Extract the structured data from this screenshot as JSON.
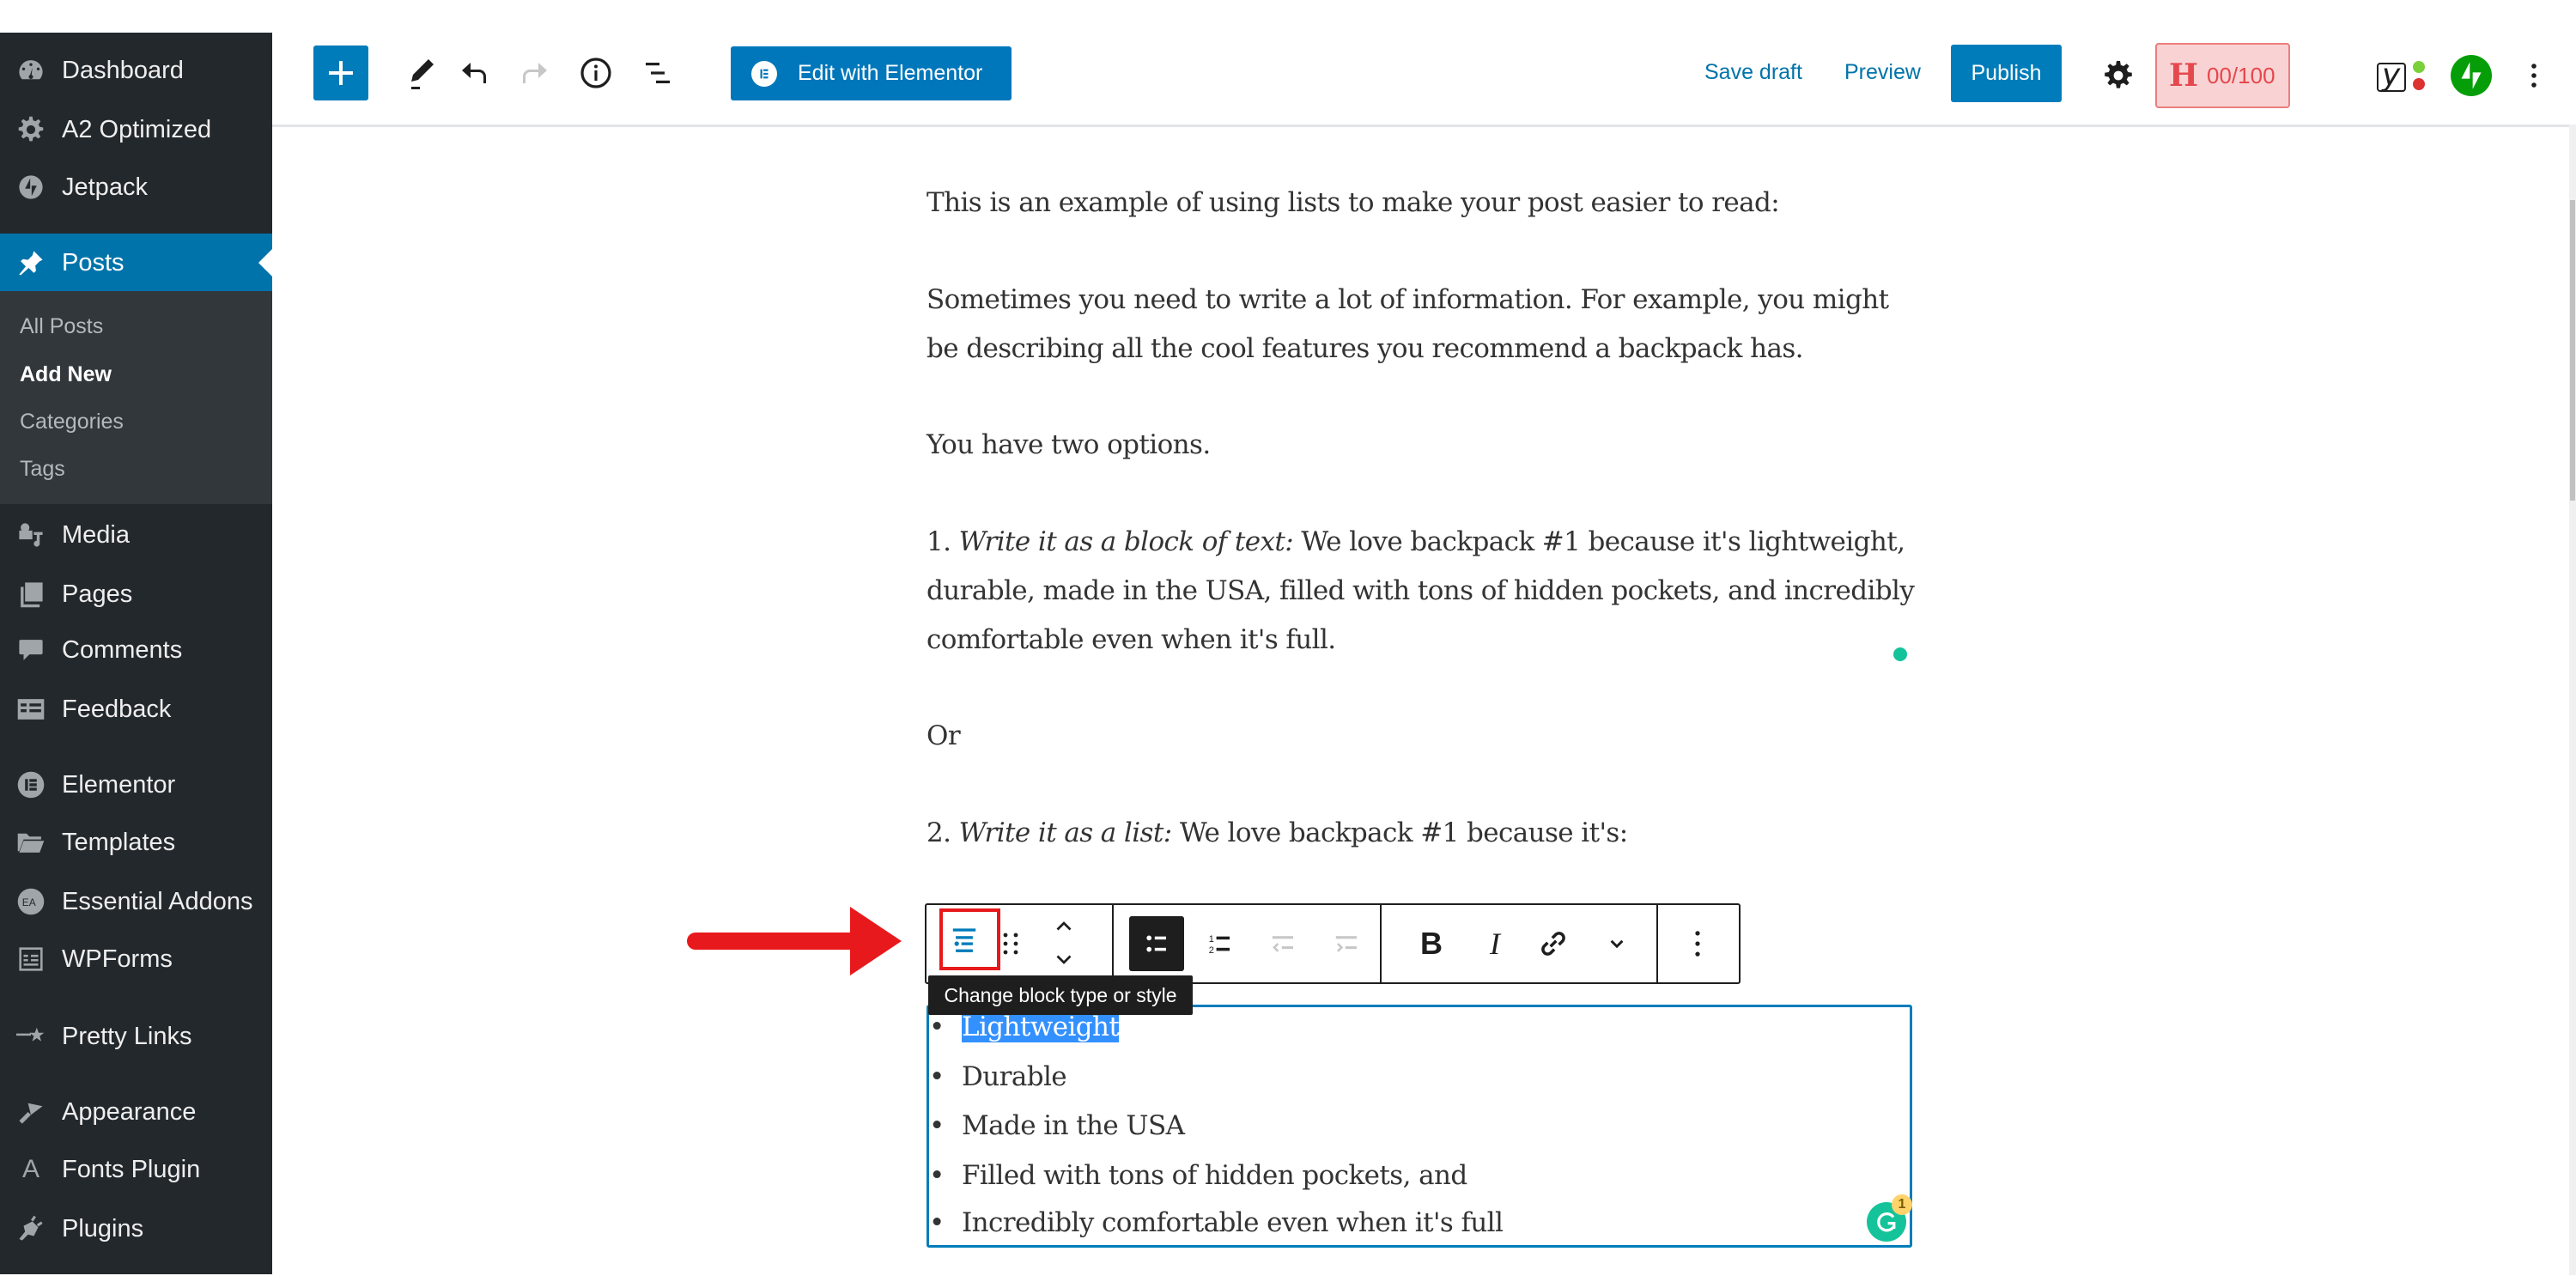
{
  "sidebar": {
    "items": [
      {
        "label": "Dashboard",
        "icon": "dashboard-icon"
      },
      {
        "label": "A2 Optimized",
        "icon": "gear-icon"
      },
      {
        "label": "Jetpack",
        "icon": "jetpack-icon"
      },
      {
        "label": "Posts",
        "icon": "pushpin-icon",
        "active": true
      },
      {
        "label": "Media",
        "icon": "media-icon"
      },
      {
        "label": "Pages",
        "icon": "pages-icon"
      },
      {
        "label": "Comments",
        "icon": "comment-icon"
      },
      {
        "label": "Feedback",
        "icon": "feedback-icon"
      },
      {
        "label": "Elementor",
        "icon": "elementor-icon"
      },
      {
        "label": "Templates",
        "icon": "folder-icon"
      },
      {
        "label": "Essential Addons",
        "icon": "essential-addons-icon"
      },
      {
        "label": "WPForms",
        "icon": "wpforms-icon"
      },
      {
        "label": "Pretty Links",
        "icon": "star-link-icon"
      },
      {
        "label": "Appearance",
        "icon": "paintbrush-icon"
      },
      {
        "label": "Fonts Plugin",
        "icon": "font-a-icon"
      },
      {
        "label": "Plugins",
        "icon": "plug-icon"
      }
    ],
    "submenu": [
      {
        "label": "All Posts"
      },
      {
        "label": "Add New",
        "current": true
      },
      {
        "label": "Categories"
      },
      {
        "label": "Tags"
      }
    ]
  },
  "header": {
    "add_block_label": "+",
    "edit_elementor_label": "Edit with Elementor",
    "save_draft_label": "Save draft",
    "preview_label": "Preview",
    "publish_label": "Publish",
    "headline_score": "00/100",
    "headline_letter": "H",
    "yoast_letter": "y"
  },
  "content": {
    "p1": "This is an example of using lists to make your post easier to read:",
    "p2_line1": "Sometimes you need to write a lot of information. For example, you might",
    "p2_line2": "be describing all the cool features you recommend a backpack has.",
    "p3": "You have two options.",
    "p4_prefix": "1. ",
    "p4_italic": "Write it as a block of text:",
    "p4_line1_rest": " We love backpack #1 because it's lightweight,",
    "p4_line2": "durable, made in the USA, filled with tons of hidden pockets, and incredibly",
    "p4_line3": "comfortable even when it's full.",
    "p5": "Or",
    "p6_prefix": "2. ",
    "p6_italic": "Write it as a list:",
    "p6_rest": " We love backpack #1 because it's:",
    "list_items": [
      "Lightweight",
      "Durable",
      "Made in the USA",
      "Filled with tons of hidden pockets, and",
      "Incredibly comfortable even when it's full"
    ],
    "bullet": "•"
  },
  "block_toolbar": {
    "tooltip": "Change block type or style",
    "bold_label": "B",
    "italic_label": "I"
  },
  "grammarly": {
    "badge_count": "1"
  },
  "colors": {
    "wp_blue": "#0073aa",
    "button_blue": "#007cba",
    "sidebar_bg": "#23282d",
    "submenu_bg": "#32373c",
    "arrow_red": "#e8191c",
    "grammarly_green": "#15c39a",
    "jetpack_green": "#069e08"
  }
}
